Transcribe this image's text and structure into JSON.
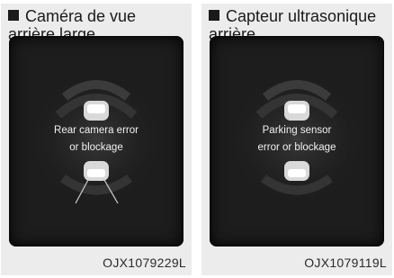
{
  "panels": [
    {
      "heading_line1": "Caméra de vue",
      "heading_line2": "arrière large",
      "message_line1": "Rear camera error",
      "message_line2": "or blockage",
      "code": "OJX1079229L"
    },
    {
      "heading_line1": "Capteur ultrasonique",
      "heading_line2": "arrière",
      "message_line1": "Parking sensor",
      "message_line2": "error or blockage",
      "code": "OJX1079119L"
    }
  ],
  "colors": {
    "panel_background": "#ececec",
    "screen_background": "#1d1d1d",
    "text_light": "#f2f2f2",
    "text_dark": "#1a1a1a"
  },
  "icons": [
    "square-bullet-icon",
    "car-rear-view-icon",
    "camera-view-lines-icon"
  ]
}
